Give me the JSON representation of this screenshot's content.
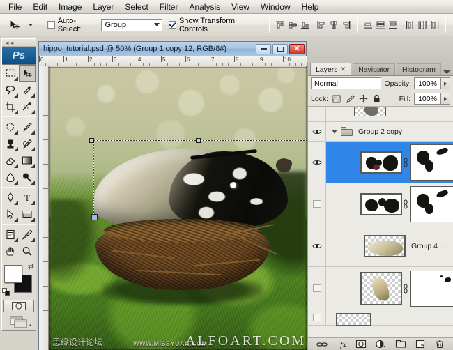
{
  "app": {
    "name": "Adobe Photoshop",
    "logo": "Ps"
  },
  "menubar": {
    "items": [
      {
        "label": "File"
      },
      {
        "label": "Edit"
      },
      {
        "label": "Image"
      },
      {
        "label": "Layer"
      },
      {
        "label": "Select"
      },
      {
        "label": "Filter"
      },
      {
        "label": "Analysis"
      },
      {
        "label": "View"
      },
      {
        "label": "Window"
      },
      {
        "label": "Help"
      }
    ]
  },
  "options_bar": {
    "active_tool_icon": "move-tool-icon",
    "auto_select": {
      "label": "Auto-Select:",
      "checked": false,
      "value": "Group"
    },
    "show_transform_controls": {
      "label": "Show Transform Controls",
      "checked": true
    },
    "align_icons": [
      "align-top-edges-icon",
      "align-vertical-centers-icon",
      "align-bottom-edges-icon",
      "align-left-edges-icon",
      "align-horizontal-centers-icon",
      "align-right-edges-icon"
    ],
    "distribute_icons": [
      "distribute-top-edges-icon",
      "distribute-vertical-centers-icon",
      "distribute-bottom-edges-icon",
      "distribute-left-edges-icon",
      "distribute-horizontal-centers-icon",
      "distribute-right-edges-icon"
    ]
  },
  "toolbox": {
    "tools": [
      {
        "name": "rectangular-marquee-tool-icon",
        "selected": false
      },
      {
        "name": "move-tool-icon",
        "selected": true
      },
      {
        "name": "lasso-tool-icon",
        "selected": false
      },
      {
        "name": "quick-selection-tool-icon",
        "selected": false
      },
      {
        "name": "crop-tool-icon",
        "selected": false
      },
      {
        "name": "slice-tool-icon",
        "selected": false
      },
      {
        "name": "patch-tool-icon",
        "selected": false
      },
      {
        "name": "brush-tool-icon",
        "selected": false
      },
      {
        "name": "clone-stamp-tool-icon",
        "selected": false
      },
      {
        "name": "history-brush-tool-icon",
        "selected": false
      },
      {
        "name": "eraser-tool-icon",
        "selected": false
      },
      {
        "name": "gradient-tool-icon",
        "selected": false
      },
      {
        "name": "blur-tool-icon",
        "selected": false
      },
      {
        "name": "dodge-tool-icon",
        "selected": false
      },
      {
        "name": "pen-tool-icon",
        "selected": false
      },
      {
        "name": "type-tool-icon",
        "selected": false
      },
      {
        "name": "path-selection-tool-icon",
        "selected": false
      },
      {
        "name": "rectangle-shape-tool-icon",
        "selected": false
      },
      {
        "name": "notes-tool-icon",
        "selected": false
      },
      {
        "name": "eyedropper-tool-icon",
        "selected": false
      },
      {
        "name": "hand-tool-icon",
        "selected": false
      },
      {
        "name": "zoom-tool-icon",
        "selected": false
      }
    ],
    "colors": {
      "foreground": "#ffffff",
      "background": "#111111"
    },
    "quick_mask": "edit-in-quick-mask-mode-icon",
    "screen_mode": "change-screen-mode-icon"
  },
  "document": {
    "title": "hippo_tutorial.psd @ 50% (Group 1 copy 12, RGB/8#)",
    "zoom": "50%",
    "active_layer": "Group 1 copy 12",
    "color_mode": "RGB/8#",
    "window_buttons": [
      "minimize-button",
      "maximize-button",
      "close-button"
    ],
    "ruler_h_ticks": [
      "0",
      "1",
      "2",
      "3",
      "4",
      "5",
      "6",
      "7",
      "8",
      "9",
      "10"
    ],
    "watermarks": {
      "cn_forum": "思缘设计论坛",
      "cn_url": "WWW.MISSYUAN.COM",
      "site": "ALFOART.COM"
    }
  },
  "panels": {
    "tabs": [
      {
        "label": "Layers",
        "active": true,
        "closable": true
      },
      {
        "label": "Navigator",
        "active": false,
        "closable": false
      },
      {
        "label": "Histogram",
        "active": false,
        "closable": false
      }
    ],
    "menu_icon": "panel-menu-icon",
    "blend": {
      "mode": "Normal",
      "opacity_label": "Opacity:",
      "opacity_value": "100%"
    },
    "lock": {
      "label": "Lock:",
      "icons": [
        "lock-transparent-pixels-icon",
        "lock-image-pixels-icon",
        "lock-position-icon",
        "lock-all-icon"
      ],
      "fill_label": "Fill:",
      "fill_value": "100%"
    },
    "layers": [
      {
        "name": "",
        "type": "layer",
        "visible": false,
        "selected": false,
        "indent": 1,
        "has_thumb": true,
        "has_mask": false,
        "partial": true
      },
      {
        "name": "Group 2 copy",
        "type": "group",
        "visible": true,
        "selected": false,
        "expanded": true,
        "indent": 0,
        "has_thumb": false,
        "has_mask": false
      },
      {
        "name": "",
        "type": "layer",
        "visible": true,
        "selected": true,
        "indent": 1,
        "has_thumb": true,
        "has_mask": true,
        "linked": true
      },
      {
        "name": "",
        "type": "layer",
        "visible": false,
        "selected": false,
        "indent": 1,
        "has_thumb": true,
        "has_mask": true,
        "linked": true
      },
      {
        "name": "Group 4 ...",
        "type": "layer",
        "visible": true,
        "selected": false,
        "indent": 1,
        "has_thumb": true,
        "has_mask": false
      },
      {
        "name": "",
        "type": "layer",
        "visible": false,
        "selected": false,
        "indent": 1,
        "has_thumb": true,
        "has_mask": true,
        "linked": true
      },
      {
        "name": "",
        "type": "layer",
        "visible": false,
        "selected": false,
        "indent": 1,
        "has_thumb": true,
        "has_mask": false,
        "partial": true
      }
    ],
    "bottom_buttons": [
      "link-layers-icon",
      "add-layer-style-icon",
      "add-layer-mask-icon",
      "new-adjustment-layer-icon",
      "new-group-icon",
      "new-layer-icon",
      "delete-layer-icon"
    ]
  },
  "colors": {
    "selection_blue": "#2f86e8",
    "titlebar_blue": "#8fb4d8",
    "close_red": "#d22f22",
    "panel_gray": "#d9d7cf"
  }
}
